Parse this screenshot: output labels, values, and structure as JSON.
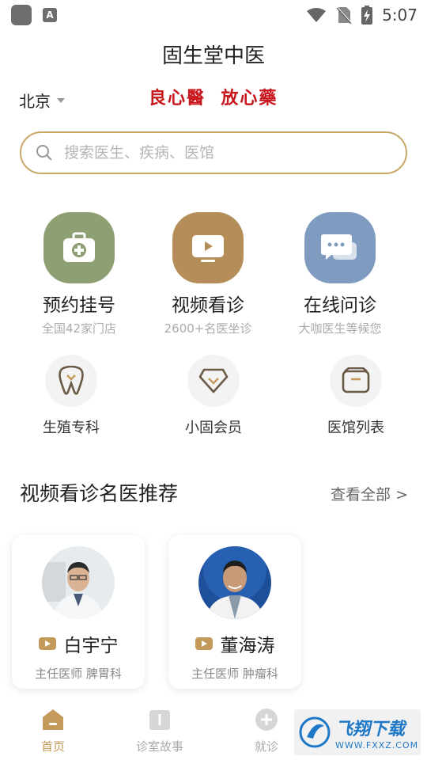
{
  "status_bar": {
    "time": "5:07"
  },
  "header": {
    "title": "固生堂中医",
    "city": "北京",
    "slogan": "良心醫  放心藥"
  },
  "search": {
    "placeholder": "搜索医生、疾病、医馆"
  },
  "features": [
    {
      "label": "预约挂号",
      "sub": "全国42家门店",
      "color": "#8e9f73",
      "icon": "medical-kit-icon"
    },
    {
      "label": "视频看诊",
      "sub": "2600+名医坐诊",
      "color": "#b48d58",
      "icon": "video-icon"
    },
    {
      "label": "在线问诊",
      "sub": "大咖医生等候您",
      "color": "#7f9bbf",
      "icon": "chat-icon"
    }
  ],
  "services": [
    {
      "label": "生殖专科",
      "icon": "tooth-icon"
    },
    {
      "label": "小固会员",
      "icon": "diamond-icon"
    },
    {
      "label": "医馆列表",
      "icon": "box-icon"
    }
  ],
  "section": {
    "title": "视频看诊名医推荐",
    "more": "查看全部 >"
  },
  "doctors": [
    {
      "name": "白宇宁",
      "title": "主任医师 脾胃科"
    },
    {
      "name": "董海涛",
      "title": "主任医师 肿瘤科"
    }
  ],
  "tabs": [
    {
      "label": "首页",
      "icon": "home-icon",
      "active": true
    },
    {
      "label": "诊室故事",
      "icon": "book-icon",
      "active": false
    },
    {
      "label": "就诊",
      "icon": "plus-circle-icon",
      "active": false
    }
  ],
  "watermark": {
    "cn": "飞翔下载",
    "en": "WWW.FXXZ.COM"
  },
  "colors": {
    "accent": "#c49a5a",
    "search_border": "#c9a868",
    "slogan": "#c8161d"
  }
}
